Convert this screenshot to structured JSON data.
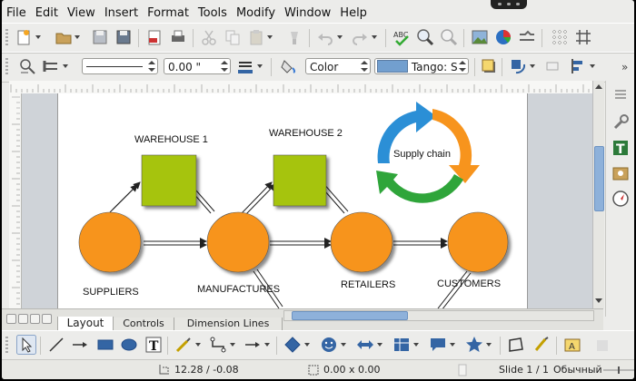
{
  "menu": [
    "File",
    "Edit",
    "View",
    "Insert",
    "Format",
    "Tools",
    "Modify",
    "Window",
    "Help"
  ],
  "line_toolbar": {
    "line_width": "0.00 \"",
    "area_style": "Color",
    "area_color": "Tango: S"
  },
  "slide": {
    "labels": {
      "warehouse1": "WAREHOUSE 1",
      "warehouse2": "WAREHOUSE 2",
      "suppliers": "SUPPLIERS",
      "manufactures": "MANUFACTURES",
      "retailers": "RETAILERS",
      "customers": "CUSTOMERS",
      "cycle": "Supply chain"
    },
    "colors": {
      "node": "#f7941d",
      "warehouse": "#a6c40f",
      "cycle_blue": "#2b8fd6",
      "cycle_orange": "#f7941d",
      "cycle_green": "#2fa53a"
    }
  },
  "tabs": [
    "Layout",
    "Controls",
    "Dimension Lines"
  ],
  "active_tab": "Layout",
  "status": {
    "position": "12.28 / -0.08",
    "size": "0.00 x 0.00",
    "slide": "Slide 1 / 1",
    "layout": "Обычный"
  },
  "icons": [
    "new-icon",
    "open-icon",
    "save-icon",
    "save-as-icon",
    "export-pdf-icon",
    "print-icon",
    "cut-icon",
    "copy-icon",
    "paste-icon",
    "clone-format-icon",
    "undo-icon",
    "redo-icon",
    "spellcheck-icon",
    "zoom-icon",
    "autospell-icon",
    "image-icon",
    "chart-icon",
    "navigator-icon",
    "grid-icon",
    "helplines-icon"
  ]
}
